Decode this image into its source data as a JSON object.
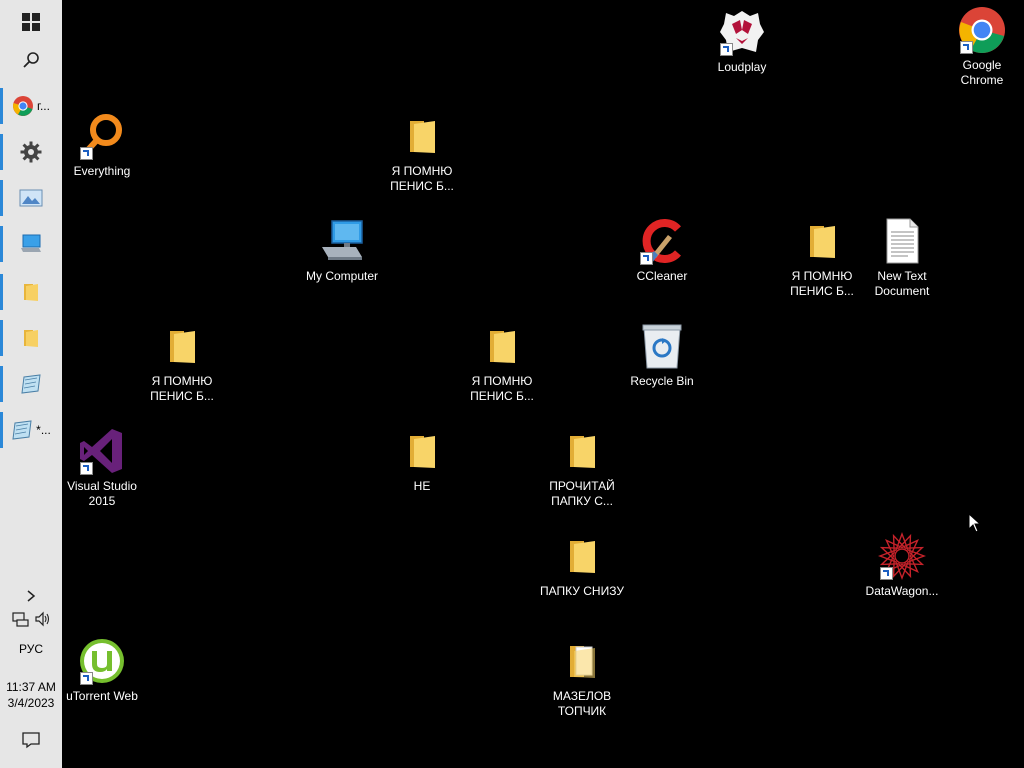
{
  "taskbar": {
    "chrome_label": "г...",
    "notepad_label": "*...",
    "language": "РУС",
    "time": "11:37 AM",
    "date": "3/4/2023"
  },
  "desktop": {
    "icons": {
      "loudplay": "Loudplay",
      "chrome": "Google Chrome",
      "everything": "Everything",
      "folder1": "Я ПОМНЮ ПЕНИС Б...",
      "my_computer": "My Computer",
      "ccleaner": "CCleaner",
      "folder2": "Я ПОМНЮ ПЕНИС Б...",
      "new_text_document": "New Text Document",
      "folder3": "Я ПОМНЮ ПЕНИС Б...",
      "folder4": "Я ПОМНЮ ПЕНИС Б...",
      "recycle_bin": "Recycle Bin",
      "visual_studio": "Visual Studio 2015",
      "folder_ne": "НЕ",
      "folder_prochitai": "ПРОЧИТАЙ ПАПКУ С...",
      "datawagon": "DataWagon...",
      "folder_papku": "ПАПКУ СНИЗУ",
      "utorrent": "uTorrent Web",
      "folder_mazelov": "МАЗЕЛОВ ТОПЧИК"
    }
  },
  "colors": {
    "desktop_bg": "#000000",
    "taskbar_bg": "#e6e6e6",
    "active_indicator": "#2b88d8",
    "folder_yellow": "#f5cd55"
  }
}
